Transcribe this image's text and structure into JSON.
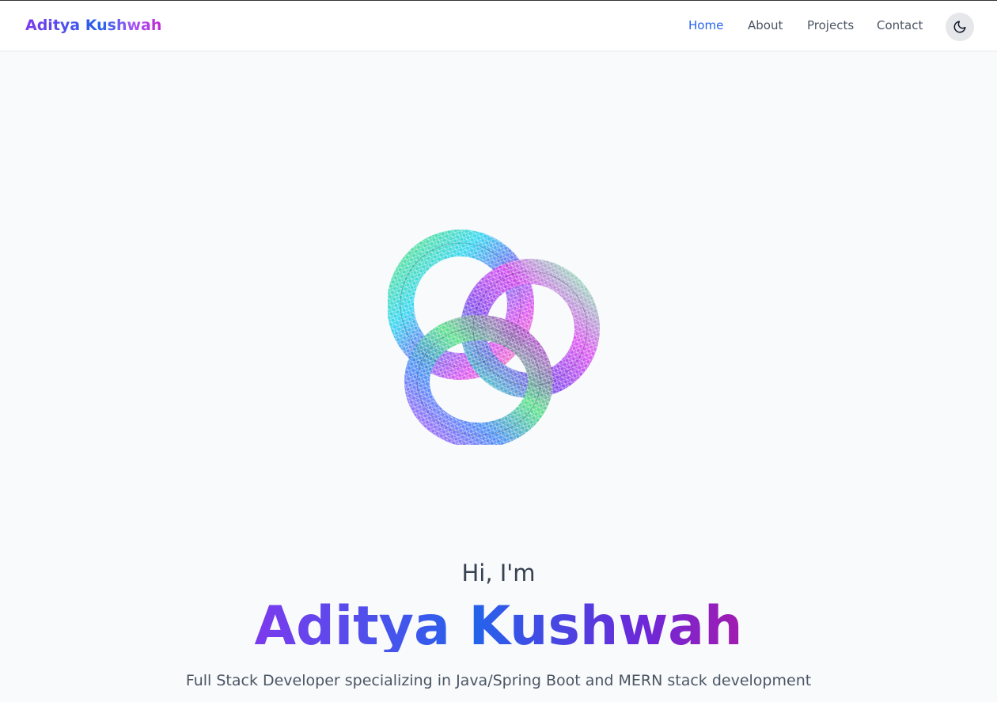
{
  "navbar": {
    "brand": "Aditya Kushwah",
    "links": [
      {
        "label": "Home",
        "active": true
      },
      {
        "label": "About",
        "active": false
      },
      {
        "label": "Projects",
        "active": false
      },
      {
        "label": "Contact",
        "active": false
      }
    ],
    "theme_toggle_icon": "moon-icon"
  },
  "hero": {
    "visual": "torus-knot-wireframe",
    "greeting": "Hi, I'm",
    "name": "Aditya Kushwah",
    "tagline": "Full Stack Developer specializing in Java/Spring Boot and MERN stack development"
  },
  "colors": {
    "accent": "#2563eb",
    "gradient_start": "#7c3aed",
    "gradient_end": "#a21caf",
    "background": "#f8fafc"
  }
}
